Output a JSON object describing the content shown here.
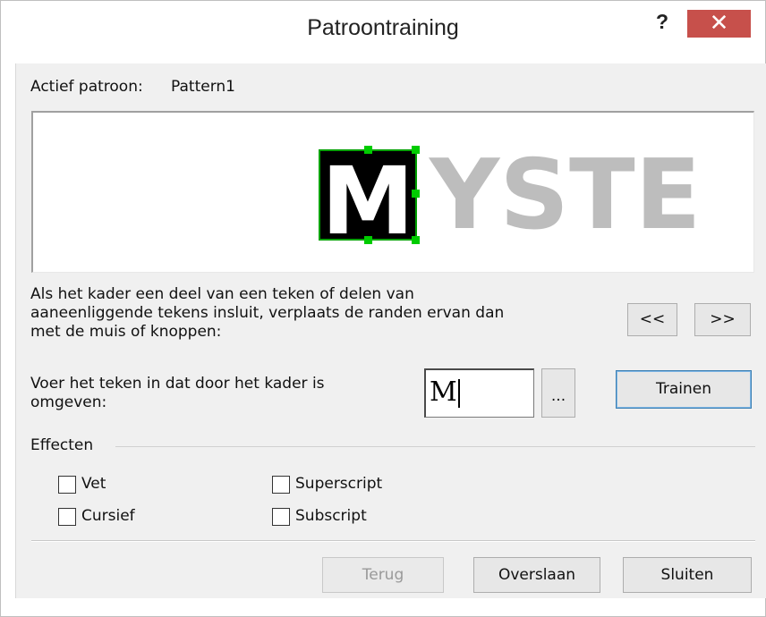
{
  "window": {
    "title": "Patroontraining",
    "help_glyph": "?",
    "close_glyph": "✕"
  },
  "active_pattern": {
    "label": "Actief patroon:",
    "value": "Pattern1"
  },
  "preview": {
    "selected_char": "M",
    "remaining_text": "YSTE"
  },
  "instructions": {
    "line1": "Als het kader een deel van een teken of delen van",
    "line2": "aaneenliggende tekens insluit, verplaats de randen ervan dan",
    "line3": "met de muis of knoppen:"
  },
  "nav": {
    "prev_label": "<<",
    "next_label": ">>"
  },
  "entry": {
    "prompt_line1": "Voer het teken in dat door het kader is",
    "prompt_line2": "omgeven:",
    "value": "M",
    "browse_label": "...",
    "train_label": "Trainen"
  },
  "effects": {
    "title": "Effecten",
    "bold": "Vet",
    "italic": "Cursief",
    "superscript": "Superscript",
    "subscript": "Subscript"
  },
  "footer": {
    "back_label": "Terug",
    "skip_label": "Overslaan",
    "close_label": "Sluiten"
  },
  "colors": {
    "selection_border": "#00a000",
    "handle": "#00cc00",
    "close_bg": "#c7504b",
    "grey_text": "#bdbdbd"
  }
}
